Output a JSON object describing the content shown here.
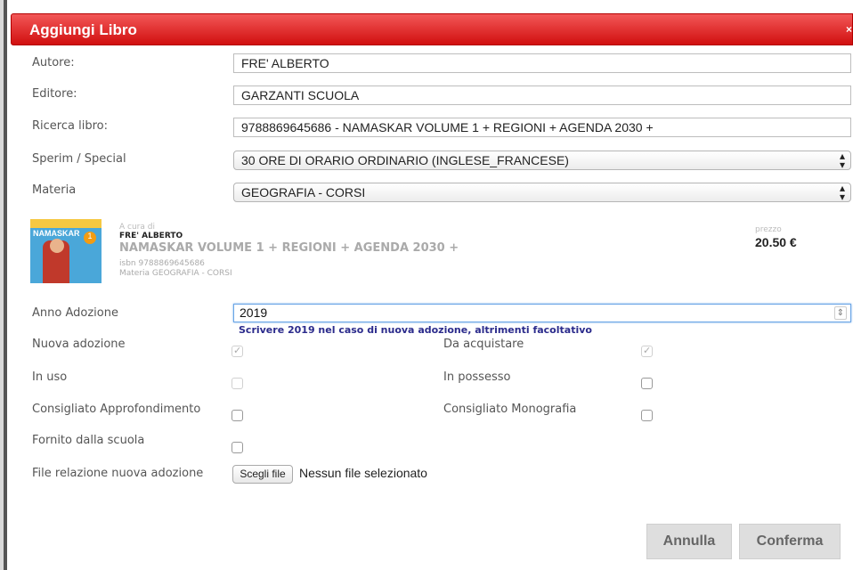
{
  "dialog": {
    "title": "Aggiungi Libro",
    "close": "×"
  },
  "form": {
    "autore_label": "Autore:",
    "autore_value": "FRE' ALBERTO",
    "editore_label": "Editore:",
    "editore_value": "GARZANTI SCUOLA",
    "ricerca_label": "Ricerca libro:",
    "ricerca_value": "9788869645686 - NAMASKAR VOLUME 1 + REGIONI + AGENDA 2030 +",
    "sperim_label": "Sperim / Special",
    "sperim_value": "30 ORE DI ORARIO ORDINARIO (INGLESE_FRANCESE)",
    "materia_label": "Materia",
    "materia_value": "GEOGRAFIA - CORSI"
  },
  "book": {
    "cover_logo": "NAMASKAR",
    "cover_number": "1",
    "a_cura_di": "A cura di",
    "author": "FRE' ALBERTO",
    "title": "NAMASKAR VOLUME 1 + REGIONI + AGENDA 2030 +",
    "isbn": "isbn 9788869645686",
    "materia": "Materia GEOGRAFIA - CORSI",
    "price_label": "prezzo",
    "price": "20.50 €"
  },
  "adoption": {
    "anno_label": "Anno Adozione",
    "anno_value": "2019",
    "hint": "Scrivere 2019 nel caso di nuova adozione, altrimenti facoltativo",
    "nuova_label": "Nuova adozione",
    "da_acquistare_label": "Da acquistare",
    "in_uso_label": "In uso",
    "in_possesso_label": "In possesso",
    "consigliato_appr_label": "Consigliato Approfondimento",
    "consigliato_mono_label": "Consigliato Monografia",
    "fornito_label": "Fornito dalla scuola",
    "file_label": "File relazione nuova adozione",
    "file_button": "Scegli file",
    "file_status": "Nessun file selezionato"
  },
  "buttons": {
    "cancel": "Annulla",
    "confirm": "Conferma"
  },
  "colors": {
    "titlebar": "#e02626",
    "hint": "#2b2b8c",
    "button_bg": "#dedede"
  }
}
